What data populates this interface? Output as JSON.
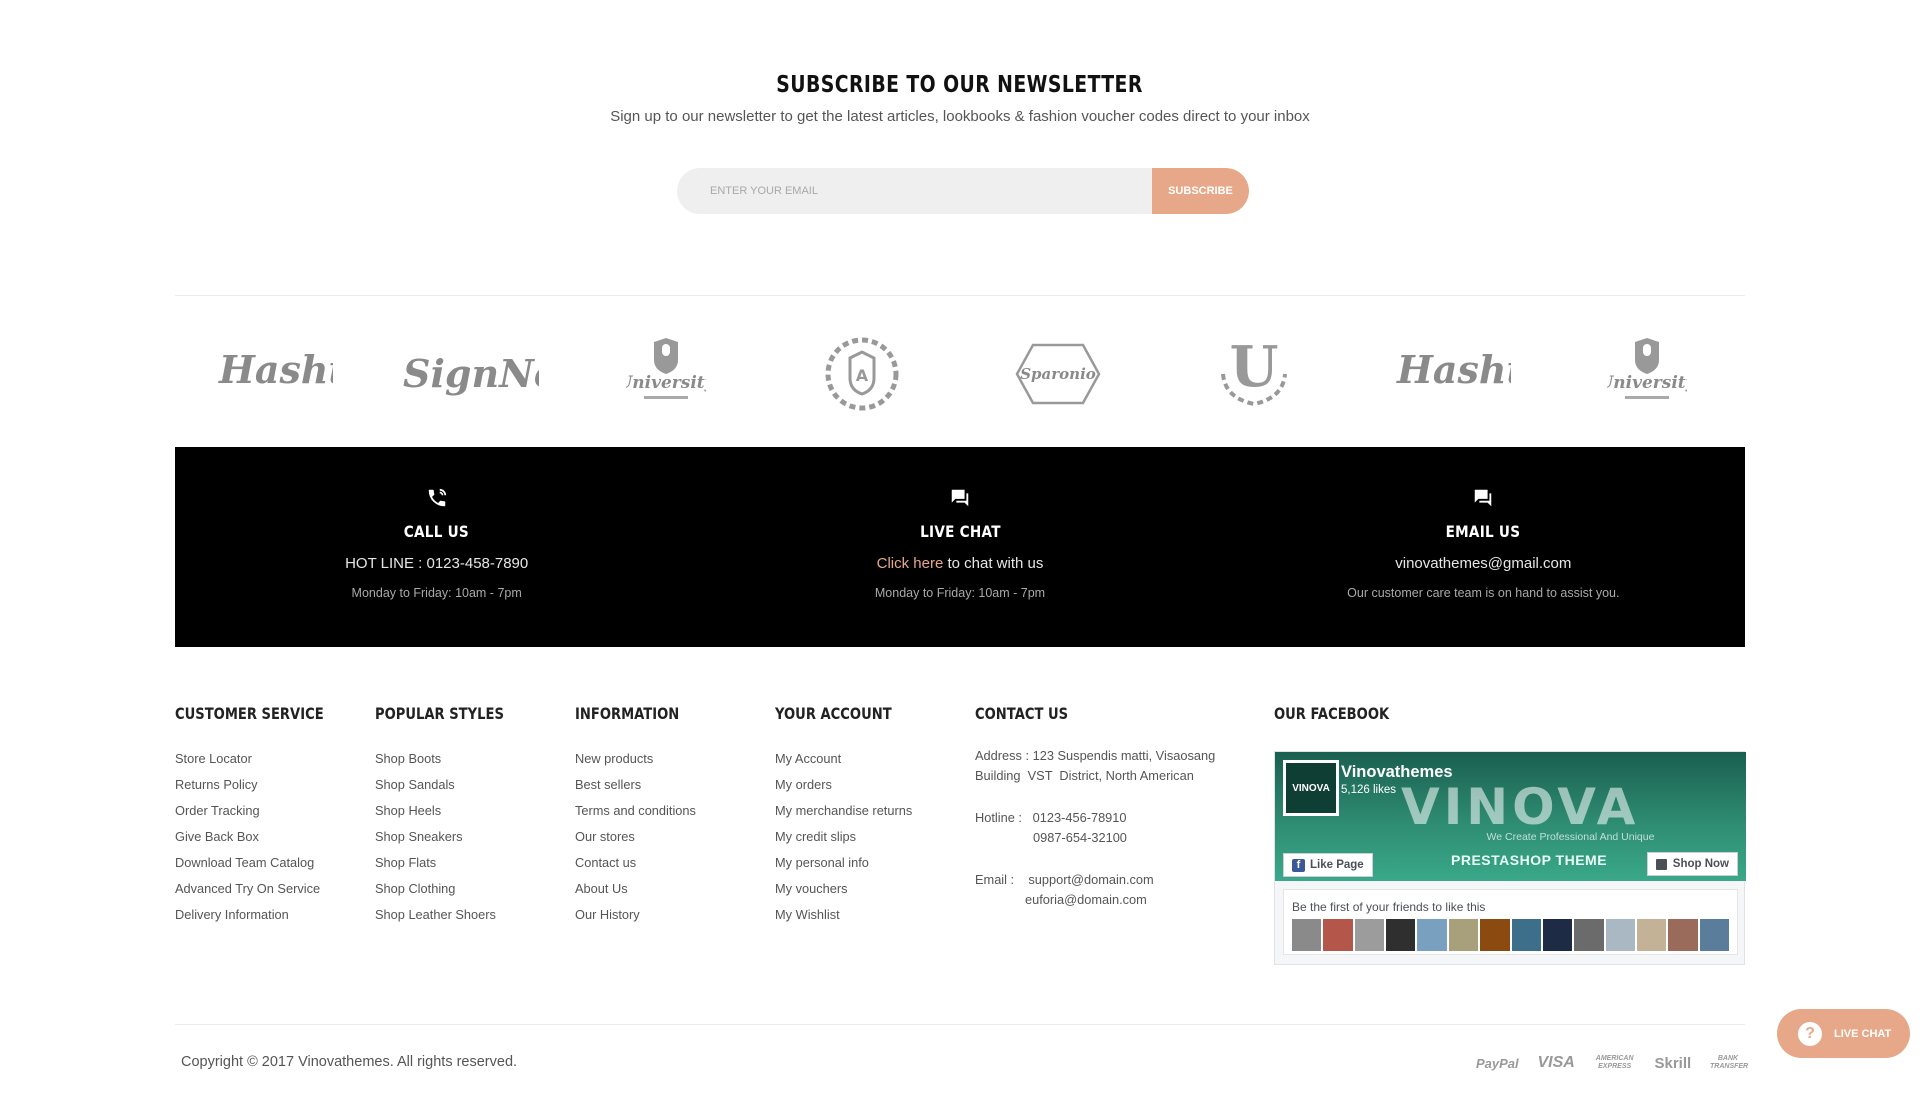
{
  "newsletter": {
    "title": "SUBSCRIBE TO OUR NEWSLETTER",
    "subtitle": "Sign up to our newsletter to get the latest articles, lookbooks & fashion voucher codes direct to your inbox",
    "email_placeholder": "ENTER YOUR EMAIL",
    "button_label": "SUBSCRIBE"
  },
  "brands": [
    "Hashtag",
    "SignNow",
    "University",
    "A",
    "Sparonio",
    "U",
    "Hashtag",
    "University"
  ],
  "contact_band": {
    "call": {
      "title": "CALL US",
      "line": "HOT LINE : 0123-458-7890",
      "note": "Monday to Friday: 10am - 7pm"
    },
    "chat": {
      "title": "LIVE CHAT",
      "link_label": "Click here",
      "line_rest": " to chat with us",
      "note": "Monday to Friday: 10am - 7pm"
    },
    "email": {
      "title": "EMAIL US",
      "line": "vinovathemes@gmail.com",
      "note": "Our customer care team is on hand to assist you."
    }
  },
  "footer": {
    "customer_service": {
      "title": "CUSTOMER SERVICE",
      "links": [
        "Store Locator",
        "Returns Policy",
        "Order Tracking",
        "Give Back Box",
        "Download Team Catalog",
        "Advanced Try On Service",
        "Delivery Information"
      ]
    },
    "popular_styles": {
      "title": "POPULAR STYLES",
      "links": [
        "Shop Boots",
        "Shop Sandals",
        "Shop Heels",
        "Shop Sneakers",
        "Shop Flats",
        "Shop Clothing",
        "Shop Leather Shoers"
      ]
    },
    "information": {
      "title": "INFORMATION",
      "links": [
        "New products",
        "Best sellers",
        "Terms and conditions",
        "Our stores",
        "Contact us",
        "About Us",
        "Our History"
      ]
    },
    "your_account": {
      "title": "YOUR ACCOUNT",
      "links": [
        "My Account",
        "My orders",
        "My merchandise returns",
        "My credit slips",
        "My personal info",
        "My vouchers",
        "My Wishlist"
      ]
    },
    "contact_us": {
      "title": "CONTACT US",
      "address_1": "Address : 123 Suspendis matti, Visaosang",
      "address_2": "Building  VST  District, North American",
      "hotline_1": "Hotline :   0123-456-78910",
      "hotline_2": "0987-654-32100",
      "email_1": "Email :    support@domain.com",
      "email_2": "euforia@domain.com"
    },
    "facebook": {
      "title": "OUR FACEBOOK",
      "page_name": "Vinovathemes",
      "likes": "5,126 likes",
      "logo_text": "VINOVA",
      "cover_brand": "VINOVA",
      "cover_tagline": "We Create Professional And Unique",
      "cover_theme": "PRESTASHOP THEME",
      "like_button": "Like Page",
      "shop_button": "Shop Now",
      "friends_text": "Be the first of your friends to like this"
    }
  },
  "copyright": "Copyright © 2017 Vinovathemes. All rights reserved.",
  "payments": [
    "PayPal",
    "VISA",
    "AMERICAN EXPRESS",
    "Skrill",
    "BANK TRANSFER"
  ],
  "live_chat_button": "LIVE CHAT",
  "colors": {
    "accent": "#e6a888",
    "band_bg": "#000000"
  }
}
